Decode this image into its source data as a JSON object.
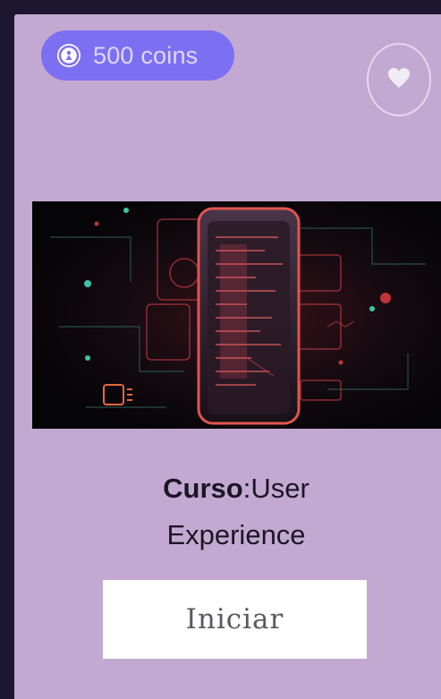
{
  "coins": {
    "icon": "coin-icon",
    "label": "500 coins"
  },
  "favorite": {
    "icon": "heart-icon"
  },
  "course": {
    "image_icon": "phone-circuit-illustration",
    "title_prefix": "Curso",
    "title_separator": ":",
    "title_line1": "User",
    "title_line2": "Experience"
  },
  "actions": {
    "start_label": "Iniciar"
  },
  "colors": {
    "page_background": "#1e1630",
    "card_background": "#c3a9d2",
    "badge_background": "#7d6ff2",
    "button_background": "#ffffff"
  }
}
